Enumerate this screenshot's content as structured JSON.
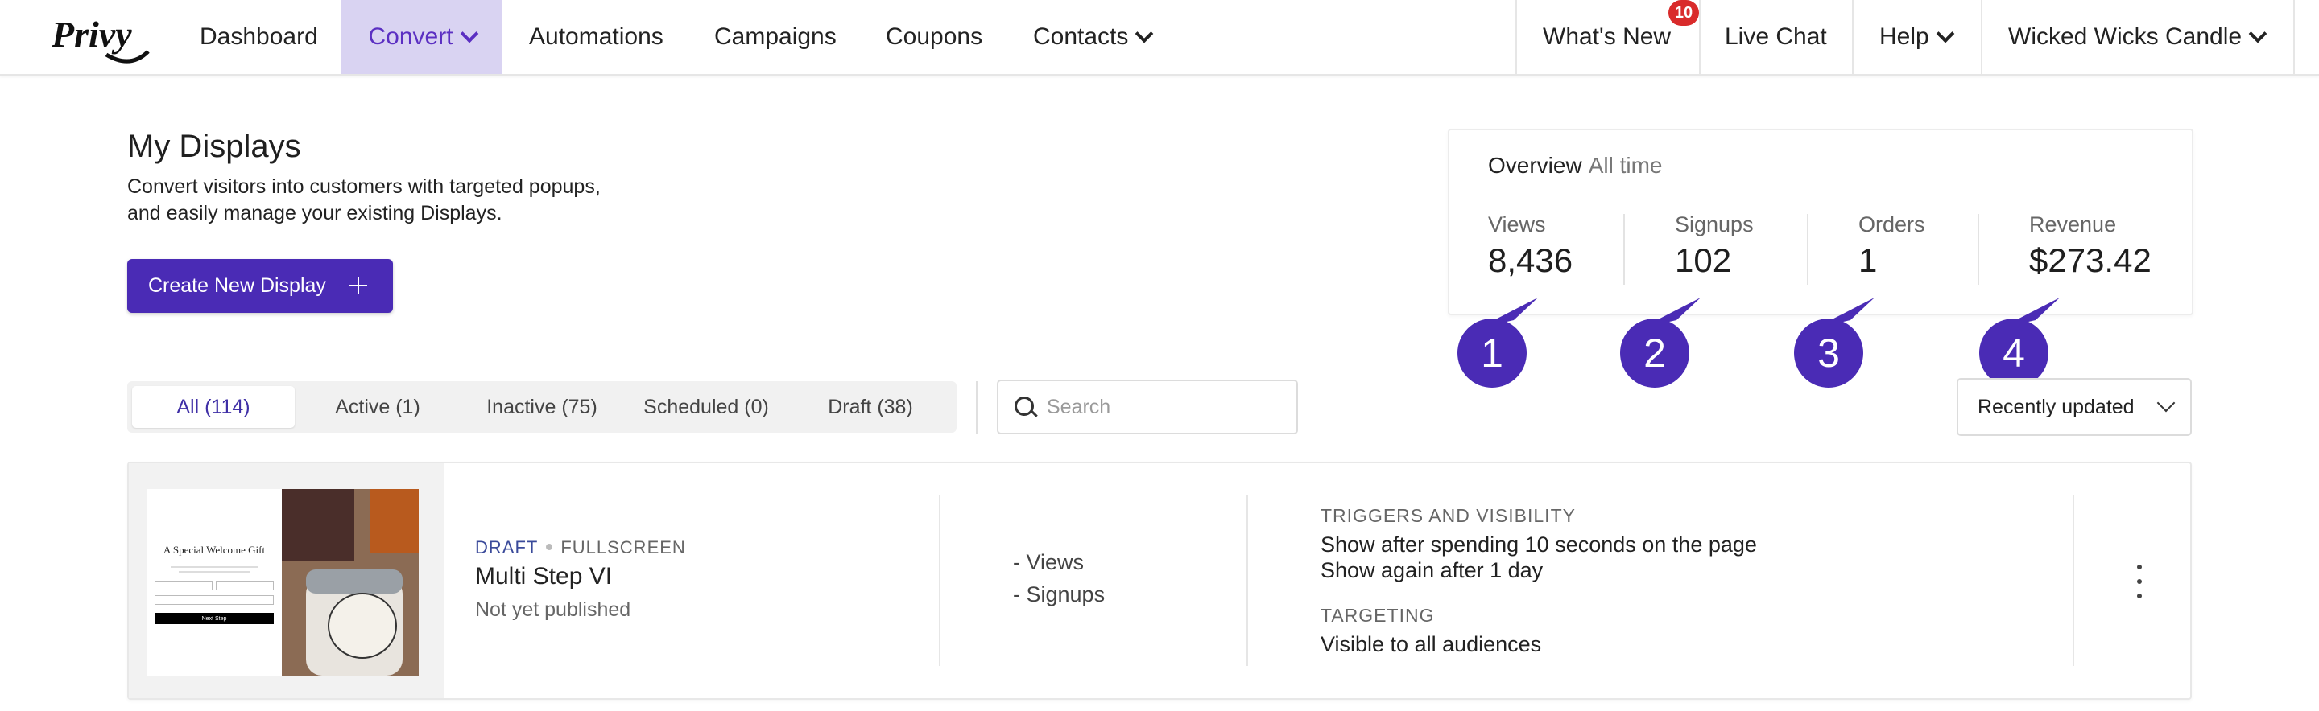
{
  "nav": {
    "brand": "Privy",
    "items": [
      {
        "label": "Dashboard"
      },
      {
        "label": "Convert"
      },
      {
        "label": "Automations"
      },
      {
        "label": "Campaigns"
      },
      {
        "label": "Coupons"
      },
      {
        "label": "Contacts"
      }
    ],
    "whats_new": "What's New",
    "whats_new_badge": "10",
    "live_chat": "Live Chat",
    "help": "Help",
    "account": "Wicked Wicks Candle",
    "accent_color": "#d9d3f2",
    "badge_color": "#d92b2b"
  },
  "header": {
    "title": "My Displays",
    "subtitle": "Convert visitors into customers with targeted popups, and easily manage your existing Displays.",
    "create_button": "Create New Display"
  },
  "overview": {
    "title": "Overview",
    "period": "All time",
    "stats": [
      {
        "label": "Views",
        "value": "8,436"
      },
      {
        "label": "Signups",
        "value": "102"
      },
      {
        "label": "Orders",
        "value": "1"
      },
      {
        "label": "Revenue",
        "value": "$273.42"
      }
    ]
  },
  "markers": [
    "1",
    "2",
    "3",
    "4"
  ],
  "tabs": [
    {
      "label": "All (114)",
      "active": true
    },
    {
      "label": "Active (1)"
    },
    {
      "label": "Inactive (75)"
    },
    {
      "label": "Scheduled (0)"
    },
    {
      "label": "Draft (38)"
    }
  ],
  "search": {
    "placeholder": "Search",
    "value": ""
  },
  "sort": {
    "selected": "Recently updated"
  },
  "displays": [
    {
      "status": "DRAFT",
      "type": "FULLSCREEN",
      "name": "Multi Step VI",
      "state": "Not yet published",
      "views": "- Views",
      "signups": "- Signups",
      "triggers_label": "TRIGGERS AND VISIBILITY",
      "trigger_1": "Show after spending 10 seconds on the page",
      "trigger_2": "Show again after 1 day",
      "targeting_label": "TARGETING",
      "targeting": "Visible to all audiences",
      "thumb_title": "A Special Welcome Gift",
      "thumb_button": "Next Step"
    }
  ],
  "colors": {
    "primary": "#4a2bb5"
  }
}
